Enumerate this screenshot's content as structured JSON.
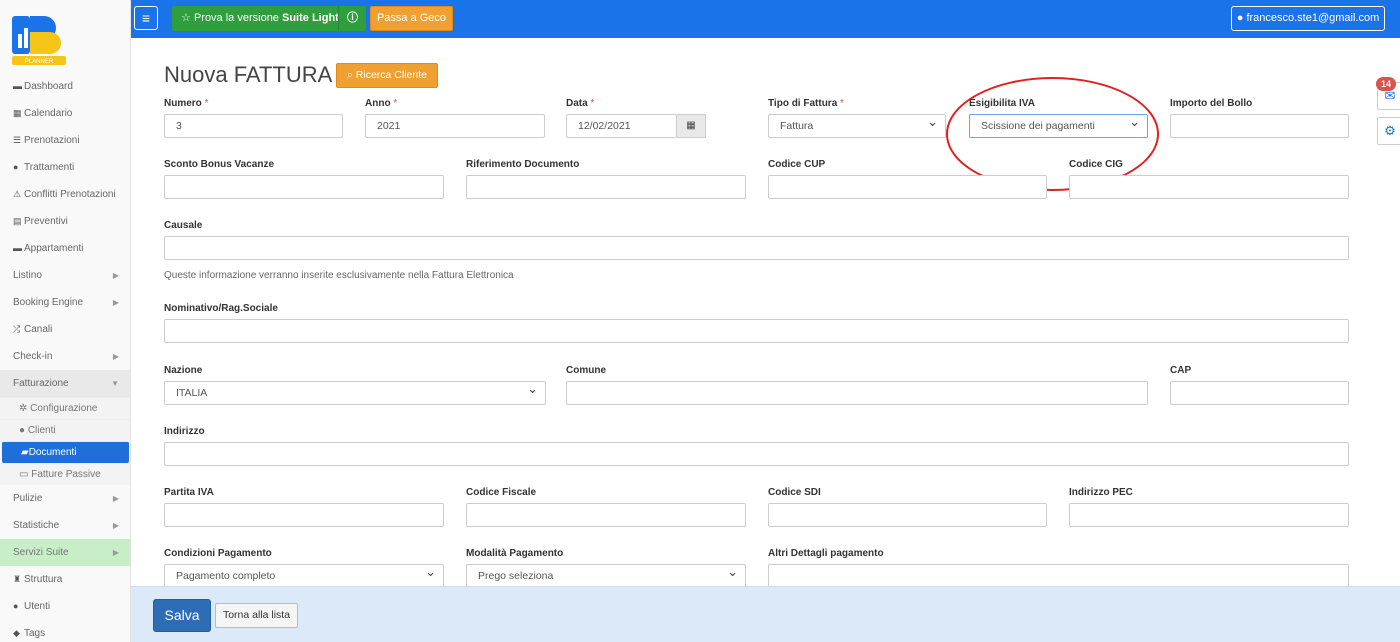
{
  "sidebar": {
    "logo_text": "PLANNER",
    "items": [
      {
        "label": "Dashboard",
        "icon": "monitor-icon"
      },
      {
        "label": "Calendario",
        "icon": "calendar-icon"
      },
      {
        "label": "Prenotazioni",
        "icon": "list-icon"
      },
      {
        "label": "Trattamenti",
        "icon": "food-icon"
      },
      {
        "label": "Conflitti Prenotazioni",
        "icon": "warning-icon"
      },
      {
        "label": "Preventivi",
        "icon": "file-icon"
      },
      {
        "label": "Appartamenti",
        "icon": "bed-icon"
      },
      {
        "label": "Listino"
      },
      {
        "label": "Booking Engine"
      },
      {
        "label": "Canali",
        "icon": "shuffle-icon"
      },
      {
        "label": "Check-in"
      },
      {
        "label": "Fatturazione"
      },
      {
        "label": "Pulizie"
      },
      {
        "label": "Statistiche"
      },
      {
        "label": "Servizi Suite"
      },
      {
        "label": "Struttura",
        "icon": "building-icon"
      },
      {
        "label": "Utenti",
        "icon": "user-icon"
      },
      {
        "label": "Tags",
        "icon": "tags-icon"
      }
    ],
    "fatturazione_sub": [
      {
        "label": "Configurazione",
        "icon": "gear-icon"
      },
      {
        "label": "Clienti",
        "icon": "user-icon"
      },
      {
        "label": "Documenti",
        "icon": "folder-open-icon"
      },
      {
        "label": "Fatture Passive",
        "icon": "credit-card-icon"
      }
    ]
  },
  "topbar": {
    "suite_prefix": "Prova la versione",
    "suite_bold": "Suite Light",
    "geco_label": "Passa a Geco",
    "user_email": "francesco.ste1@gmail.com"
  },
  "page": {
    "title": "Nuova FATTURA",
    "search_client_label": "Ricerca Cliente"
  },
  "form": {
    "numero": {
      "label": "Numero",
      "value": "3"
    },
    "anno": {
      "label": "Anno",
      "value": "2021"
    },
    "data": {
      "label": "Data",
      "value": "12/02/2021"
    },
    "tipo_fattura": {
      "label": "Tipo di Fattura",
      "value": "Fattura"
    },
    "esigibilita_iva": {
      "label": "Esigibilita IVA",
      "value": "Scissione dei pagamenti"
    },
    "importo_bollo": {
      "label": "Importo del Bollo",
      "value": ""
    },
    "sconto_bonus": {
      "label": "Sconto Bonus Vacanze",
      "value": ""
    },
    "riferimento_doc": {
      "label": "Riferimento Documento",
      "value": ""
    },
    "codice_cup": {
      "label": "Codice CUP",
      "value": ""
    },
    "codice_cig": {
      "label": "Codice CIG",
      "value": ""
    },
    "causale": {
      "label": "Causale",
      "value": ""
    },
    "causale_hint": "Queste informazione verranno inserite esclusivamente nella Fattura Elettronica",
    "nominativo": {
      "label": "Nominativo/Rag.Sociale",
      "value": ""
    },
    "nazione": {
      "label": "Nazione",
      "value": "ITALIA"
    },
    "comune": {
      "label": "Comune",
      "value": ""
    },
    "cap": {
      "label": "CAP",
      "value": ""
    },
    "indirizzo": {
      "label": "Indirizzo",
      "value": ""
    },
    "partita_iva": {
      "label": "Partita IVA",
      "value": ""
    },
    "codice_fiscale": {
      "label": "Codice Fiscale",
      "value": ""
    },
    "codice_sdi": {
      "label": "Codice SDI",
      "value": ""
    },
    "indirizzo_pec": {
      "label": "Indirizzo PEC",
      "value": ""
    },
    "condizioni_pagamento": {
      "label": "Condizioni Pagamento",
      "value": "Pagamento completo"
    },
    "modalita_pagamento": {
      "label": "Modalità Pagamento",
      "value": "Prego seleziona"
    },
    "altri_dettagli": {
      "label": "Altri Dettagli pagamento",
      "value": ""
    },
    "required_mark": "*"
  },
  "floating": {
    "messages_badge": "14"
  },
  "footer": {
    "save_label": "Salva",
    "back_label": "Torna alla lista"
  },
  "colors": {
    "topbar": "#1a73e8",
    "suite_button": "#2e9e3e",
    "orange_button": "#f0a030",
    "save_button": "#2c6db5",
    "highlight_ellipse": "#e02020",
    "active_nav": "#1e6fd9"
  }
}
